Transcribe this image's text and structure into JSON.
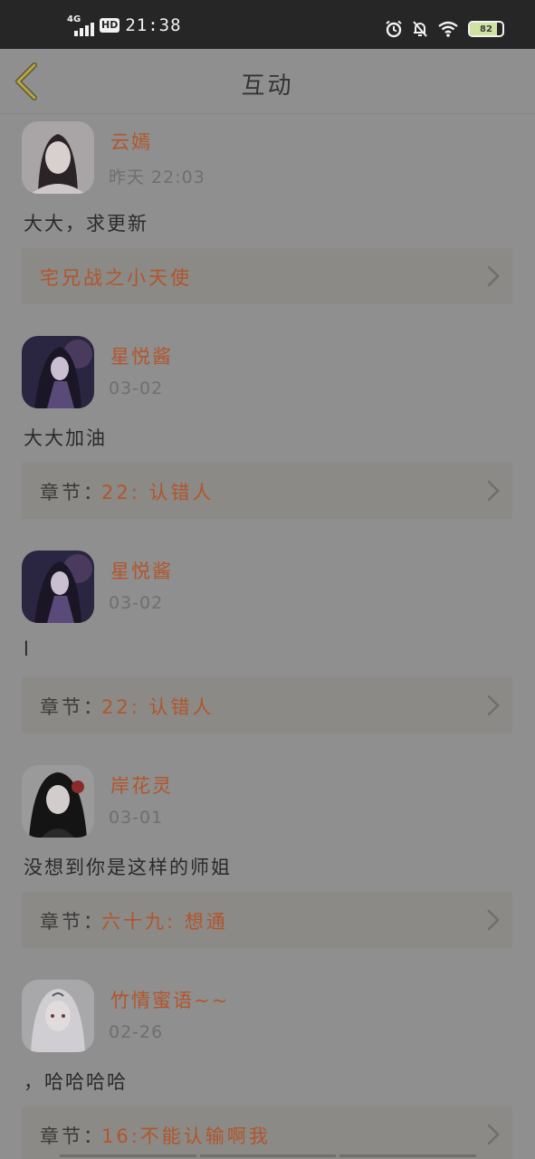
{
  "status_bar": {
    "network": "4G",
    "hd": "HD",
    "time": "21:38",
    "battery": "82",
    "battery_level": 0.82
  },
  "header": {
    "title": "互动"
  },
  "comments": [
    {
      "username": "云嫣",
      "time": "昨天 22:03",
      "text": "大大，求更新",
      "chapter_prefix": "",
      "chapter_title": "宅兄战之小天使"
    },
    {
      "username": "星悦酱",
      "time": "03-02",
      "text": "大大加油",
      "chapter_prefix": "章节：",
      "chapter_title": "22: 认错人"
    },
    {
      "username": "星悦酱",
      "time": "03-02",
      "text": "l",
      "chapter_prefix": "章节：",
      "chapter_title": "22: 认错人"
    },
    {
      "username": "岸花灵",
      "time": "03-01",
      "text": "没想到你是这样的师姐",
      "chapter_prefix": "章节：",
      "chapter_title": "六十九: 想通"
    },
    {
      "username": "竹情蜜语~~",
      "time": "02-26",
      "text": "，哈哈哈哈",
      "chapter_prefix": "章节：",
      "chapter_title": "16:不能认输啊我"
    }
  ]
}
